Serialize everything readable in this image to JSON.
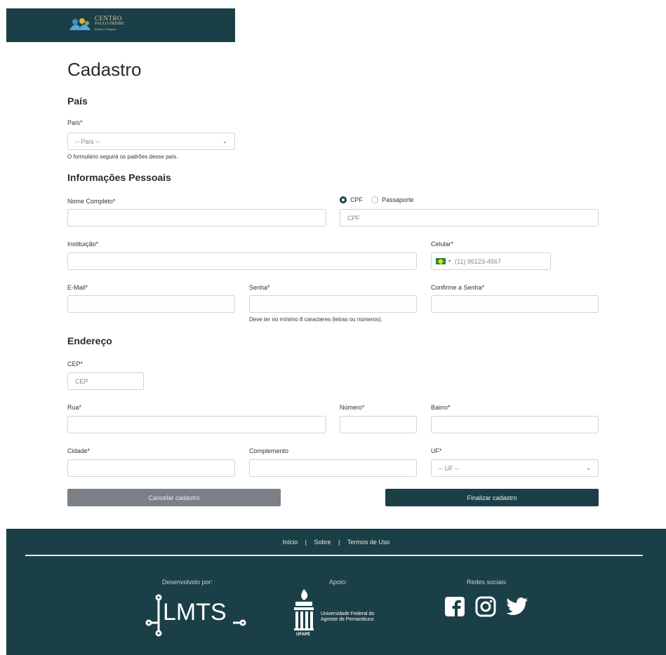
{
  "header": {
    "logo_line1": "CENTRO",
    "logo_line2": "PAULO FREIRE",
    "logo_line3": "Estudos e Pesquisa"
  },
  "page_title": "Cadastro",
  "sections": {
    "country": "País",
    "personal": "Informações Pessoais",
    "address": "Endereço"
  },
  "country": {
    "label": "País*",
    "value": "-- País --",
    "hint": "O formulário seguirá os padrões desse país."
  },
  "personal": {
    "full_name_label": "Nome Completo*",
    "doc_options": [
      "CPF",
      "Passaporte"
    ],
    "doc_selected": "CPF",
    "doc_placeholder": "CPF",
    "institution_label": "Instituição*",
    "phone_label": "Celular*",
    "phone_placeholder": "(11) 96123-4567",
    "email_label": "E-Mail*",
    "password_label": "Senha*",
    "password_hint": "Deve ter no mínimo 8 caracteres (letras ou números).",
    "confirm_password_label": "Confirme a Senha*"
  },
  "address": {
    "cep_label": "CEP*",
    "cep_placeholder": "CEP",
    "street_label": "Rua*",
    "number_label": "Número*",
    "district_label": "Bairro*",
    "city_label": "Cidade*",
    "complement_label": "Complemento",
    "state_label": "UF*",
    "state_value": "-- UF --"
  },
  "buttons": {
    "cancel": "Cancelar cadastro",
    "finish": "Finalizar cadastro"
  },
  "footer": {
    "links": [
      "Início",
      "Sobre",
      "Termos de Uso"
    ],
    "separator": "|",
    "developed_by": "Desenvolvido por:",
    "support": "Apoio:",
    "social": "Redes sociais",
    "lmts_logo_text": "LMTS",
    "ufape_line1": "Universidade Federal do",
    "ufape_line2": "Agreste de Pernambuco",
    "ufape_short": "UFAPE"
  },
  "colors": {
    "brand": "#1b3f47",
    "cancel": "#7a8086",
    "logo_gold": "#d6c9a4"
  }
}
